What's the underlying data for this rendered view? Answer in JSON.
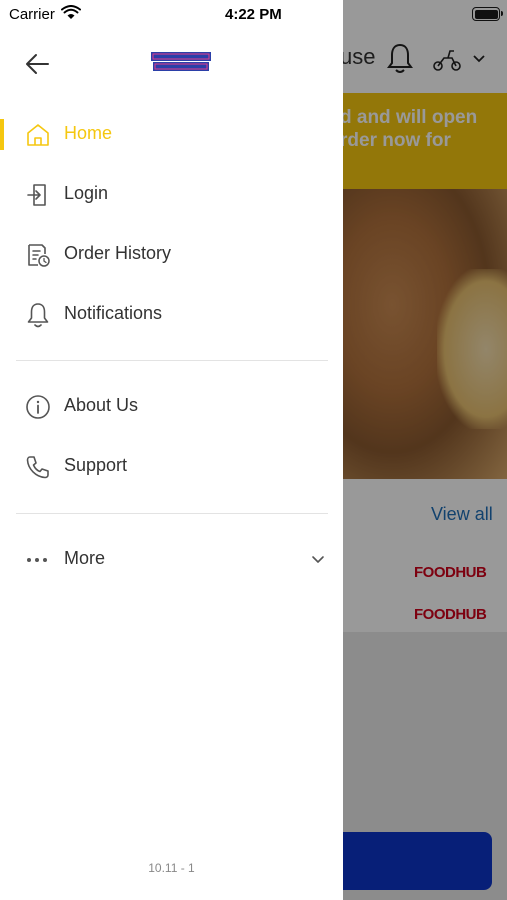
{
  "status_bar": {
    "carrier": "Carrier",
    "time": "4:22 PM"
  },
  "background": {
    "header_partial": "use",
    "banner_text": "d and will open\nrder now for",
    "view_all": "View all",
    "partners": [
      "FOODHUB",
      "FOODHUB"
    ],
    "colors": {
      "banner": "#f5c710",
      "cta": "#0d35c8",
      "foodhub": "#d0021b",
      "link": "#1e6eb8"
    }
  },
  "drawer": {
    "menu": [
      {
        "label": "Home",
        "icon": "home-icon",
        "active": true
      },
      {
        "label": "Login",
        "icon": "login-icon"
      },
      {
        "label": "Order History",
        "icon": "order-history-icon"
      },
      {
        "label": "Notifications",
        "icon": "bell-icon"
      },
      {
        "label": "About Us",
        "icon": "info-icon"
      },
      {
        "label": "Support",
        "icon": "phone-icon"
      },
      {
        "label": "More",
        "icon": "more-dots-icon"
      }
    ],
    "version": "10.11 - 1",
    "accent_color": "#f5c710"
  }
}
